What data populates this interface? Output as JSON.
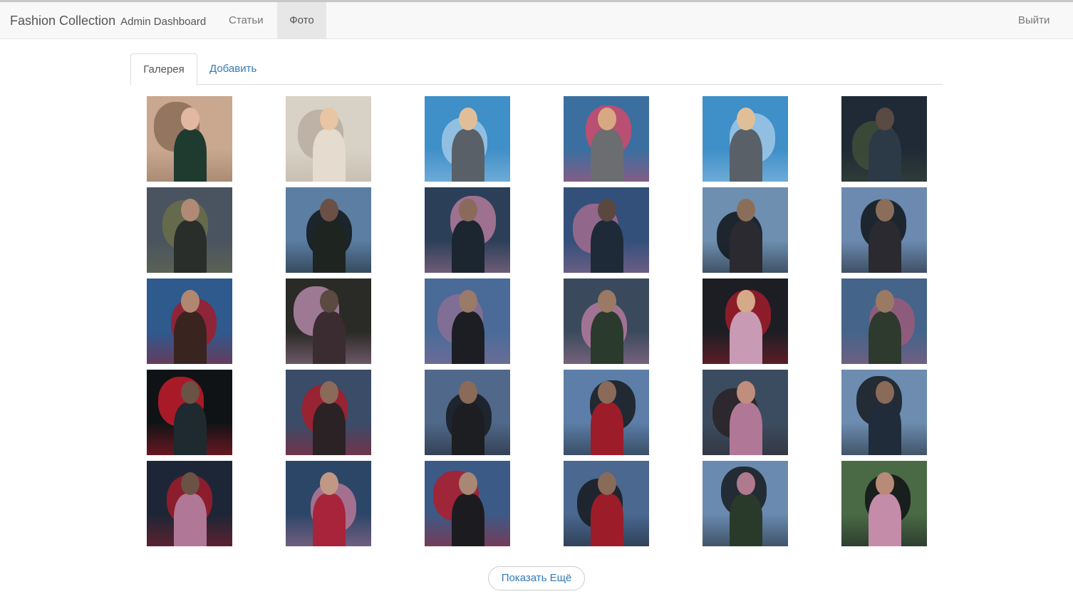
{
  "navbar": {
    "brand": "Fashion Collection",
    "brand_sub": "Admin Dashboard",
    "items": [
      {
        "label": "Статьи"
      },
      {
        "label": "Фото"
      }
    ],
    "logout": "Выйти"
  },
  "tabs": {
    "gallery": "Галерея",
    "add": "Добавить"
  },
  "gallery": {
    "photos": [
      {
        "bg": "#c9a88f",
        "body": "#1f3b2f",
        "head": "#e2b9a0",
        "shape": "#8b6d58"
      },
      {
        "bg": "#d8d1c6",
        "body": "#e6dbcf",
        "head": "#e8c6a4",
        "shape": "#b9ad9f"
      },
      {
        "bg": "#3f8fc8",
        "body": "#5a6068",
        "head": "#e0bf98",
        "shape": "#9fc8e6"
      },
      {
        "bg": "#3a6fa0",
        "body": "#6c6d70",
        "head": "#d8a882",
        "shape": "#d04a6a"
      },
      {
        "bg": "#3f8fc8",
        "body": "#5a6068",
        "head": "#e0bf98",
        "shape": "#9fc8e6"
      },
      {
        "bg": "#1f2a36",
        "body": "#2c3a48",
        "head": "#5a4a44",
        "shape": "#3f4e38"
      },
      {
        "bg": "#4a5460",
        "body": "#2a2e2a",
        "head": "#b08a76",
        "shape": "#6b6f4a"
      },
      {
        "bg": "#5c7ea2",
        "body": "#1e2420",
        "head": "#6b5045",
        "shape": "#101418"
      },
      {
        "bg": "#2c3f58",
        "body": "#1c2630",
        "head": "#8a6a5a",
        "shape": "#b27a99"
      },
      {
        "bg": "#33507a",
        "body": "#1e2a38",
        "head": "#5a4840",
        "shape": "#a36b8f"
      },
      {
        "bg": "#6e8fb0",
        "body": "#2a2a30",
        "head": "#8a6e5a",
        "shape": "#0f1418"
      },
      {
        "bg": "#6c8ab0",
        "body": "#2a2a30",
        "head": "#8a6e5a",
        "shape": "#0f1418"
      },
      {
        "bg": "#2e5a8e",
        "body": "#3a2420",
        "head": "#b08870",
        "shape": "#a01c2a"
      },
      {
        "bg": "#2a2a26",
        "body": "#3a2c30",
        "head": "#5a4a40",
        "shape": "#b287a8"
      },
      {
        "bg": "#4a6b98",
        "body": "#1c1e24",
        "head": "#9a7a68",
        "shape": "#8a6e94"
      },
      {
        "bg": "#3a4a5c",
        "body": "#2a3a2c",
        "head": "#9a7a64",
        "shape": "#b47a9c"
      },
      {
        "bg": "#1c1e24",
        "body": "#c89ab4",
        "head": "#d4aa88",
        "shape": "#a01c2a"
      },
      {
        "bg": "#44648a",
        "body": "#2e3a2e",
        "head": "#9a7a64",
        "shape": "#9a5a7a"
      },
      {
        "bg": "#101316",
        "body": "#1e2a30",
        "head": "#6a5244",
        "shape": "#c41c2c"
      },
      {
        "bg": "#3a4c68",
        "body": "#2a2224",
        "head": "#8a6a58",
        "shape": "#a81c2a"
      },
      {
        "bg": "#50688a",
        "body": "#1c1e22",
        "head": "#8a6a58",
        "shape": "#161a1e"
      },
      {
        "bg": "#5c7ea8",
        "body": "#9c1c2a",
        "head": "#8a6a58",
        "shape": "#161a1e"
      },
      {
        "bg": "#3c4c60",
        "body": "#b07896",
        "head": "#c08e7c",
        "shape": "#2a2226"
      },
      {
        "bg": "#6c8cb0",
        "body": "#202c3a",
        "head": "#8a6a58",
        "shape": "#161a1e"
      },
      {
        "bg": "#1c2636",
        "body": "#b07896",
        "head": "#6a5244",
        "shape": "#a01c2a"
      },
      {
        "bg": "#2c4668",
        "body": "#a8243a",
        "head": "#c09884",
        "shape": "#b87896"
      },
      {
        "bg": "#3c5a86",
        "body": "#1c1c20",
        "head": "#a88874",
        "shape": "#b01c2a"
      },
      {
        "bg": "#4a6890",
        "body": "#9c1c2a",
        "head": "#8a6a58",
        "shape": "#161a1e"
      },
      {
        "bg": "#6a8ab0",
        "body": "#2a3a2a",
        "head": "#b07a8e",
        "shape": "#161a1e"
      },
      {
        "bg": "#4a6a46",
        "body": "#c48ca8",
        "head": "#b88a78",
        "shape": "#101216"
      }
    ]
  },
  "load_more": "Показать Ещё"
}
